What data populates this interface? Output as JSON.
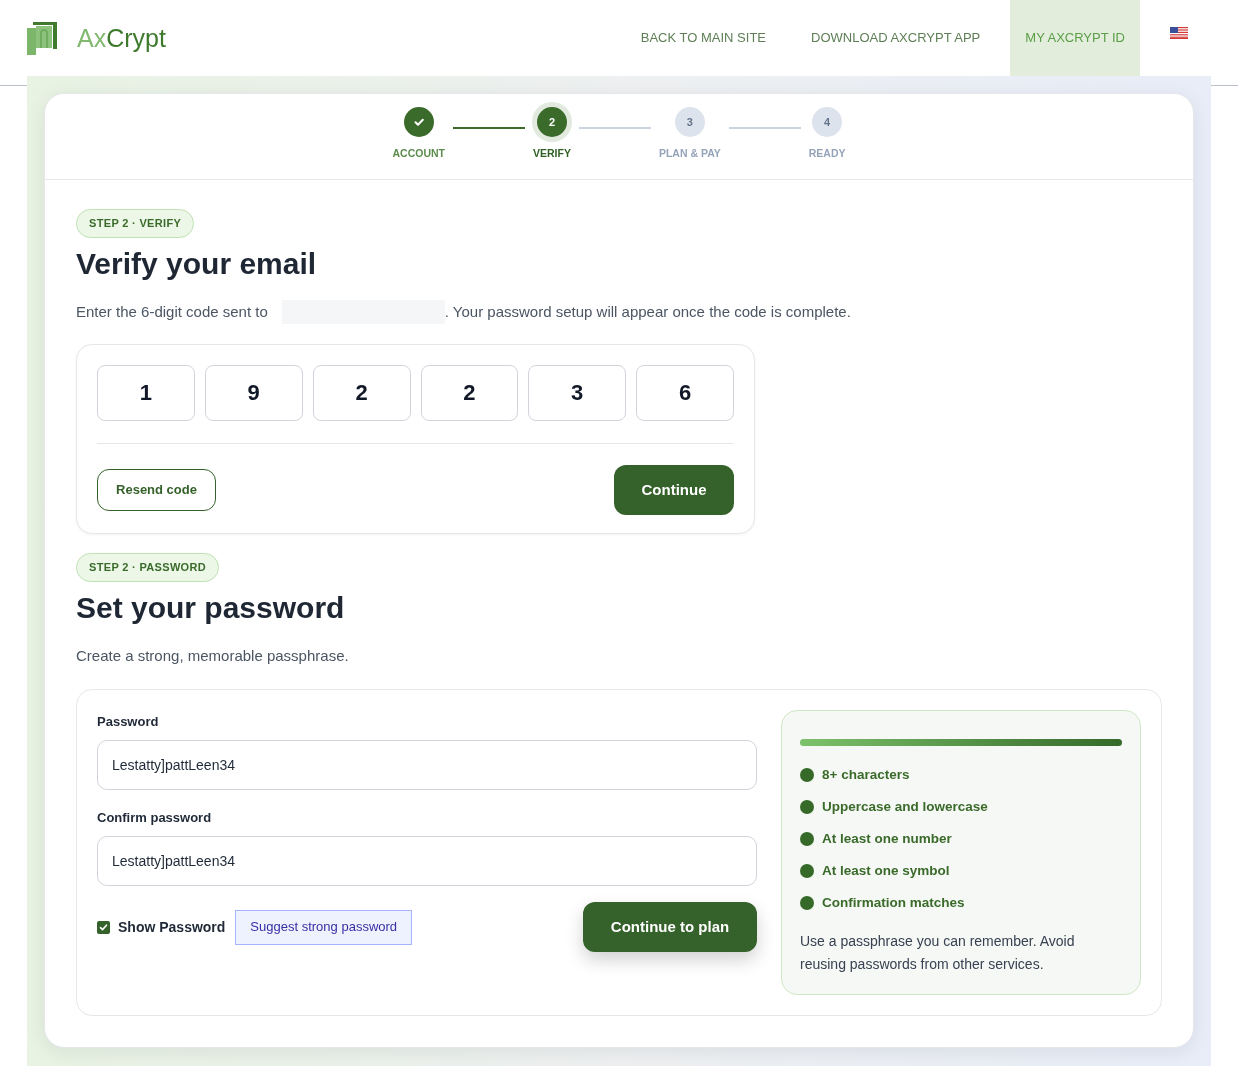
{
  "header": {
    "logo": {
      "text": [
        "Ax",
        "Crypt"
      ]
    },
    "nav": [
      {
        "label": "BACK TO MAIN SITE",
        "selected": false
      },
      {
        "label": "DOWNLOAD AXCRYPT APP",
        "selected": false
      },
      {
        "label": "MY AXCRYPT ID",
        "selected": true
      }
    ]
  },
  "stepper": [
    {
      "label": "ACCOUNT",
      "completed": true,
      "current": false
    },
    {
      "label": "VERIFY",
      "number": "2",
      "completed": false,
      "current": true
    },
    {
      "label": "PLAN & PAY",
      "number": "3",
      "completed": false,
      "current": false
    },
    {
      "label": "READY",
      "number": "4",
      "completed": false,
      "current": false
    }
  ],
  "verify": {
    "badge": "STEP 2 · VERIFY",
    "title": "Verify your email",
    "text_before": "Enter the 6-digit code sent to",
    "text_after": ". Your password setup will appear once the code is complete.",
    "code_digits": [
      "1",
      "9",
      "2",
      "2",
      "3",
      "6"
    ],
    "resend_button": "Resend code",
    "continue_button": "Continue"
  },
  "password": {
    "badge": "STEP 2 · PASSWORD",
    "title": "Set your password",
    "subtitle": "Create a strong, memorable passphrase.",
    "fields": [
      {
        "label": "Password",
        "value": "Lestatty]pattLeen34"
      },
      {
        "label": "Confirm password",
        "value": "Lestatty]pattLeen34"
      }
    ],
    "show_password": {
      "label": "Show Password",
      "checked": true
    },
    "suggest_button": "Suggest strong password",
    "continue_button": "Continue to plan",
    "strength": {
      "level": 1
    },
    "requirements": [
      {
        "label": "8+ characters",
        "met": true
      },
      {
        "label": "Uppercase and lowercase",
        "met": true
      },
      {
        "label": "At least one number",
        "met": true
      },
      {
        "label": "At least one symbol",
        "met": true
      },
      {
        "label": "Confirmation matches",
        "met": true
      }
    ],
    "note": "Use a passphrase you can remember. Avoid reusing passwords from other services."
  }
}
